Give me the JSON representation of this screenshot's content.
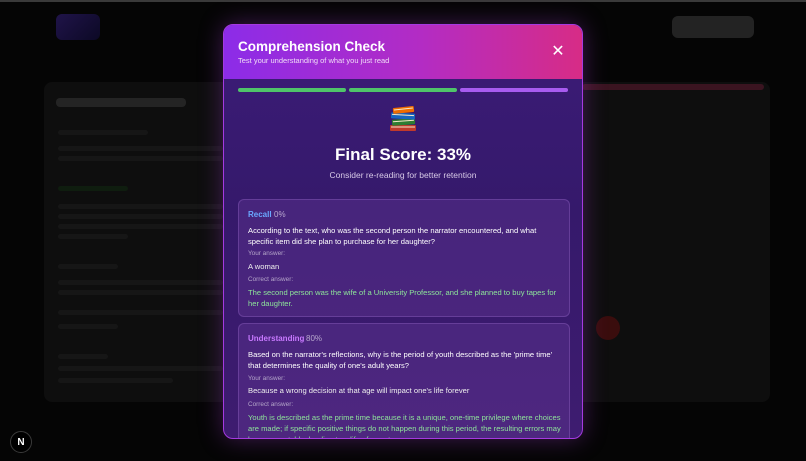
{
  "modal": {
    "title": "Comprehension Check",
    "subtitle": "Test your understanding of what you just read",
    "close_icon": "close-icon",
    "progress": [
      "complete",
      "complete",
      "active"
    ],
    "result_icon": "books-icon",
    "score_text": "Final Score: 33%",
    "score_note": "Consider re-reading for better retention",
    "labels": {
      "your_answer": "Your answer:",
      "correct_answer": "Correct answer:"
    },
    "questions": [
      {
        "category": "Recall",
        "percent": "0%",
        "question": "According to the text, who was the second person the narrator encountered, and what specific item did she plan to purchase for her daughter?",
        "your_answer": "A woman",
        "correct_answer": "The second person was the wife of a University Professor, and she planned to buy tapes for her daughter."
      },
      {
        "category": "Understanding",
        "percent": "80%",
        "question": "Based on the narrator's reflections, why is the period of youth described as the 'prime time' that determines the quality of one's adult years?",
        "your_answer": "Because a wrong decision at that age will impact one's life forever",
        "correct_answer": "Youth is described as the prime time because it is a unique, one-time privilege where choices are made; if specific positive things do not happen during this period, the resulting errors may be uncorrectable, leading to a life of regret."
      }
    ]
  },
  "background": {
    "badge_letter": "N"
  },
  "colors": {
    "header_start": "#8c2ce8",
    "header_end": "#d72c86",
    "progress_done": "#4fc46a",
    "progress_active": "#a85cf0",
    "recall": "#6aa8ff",
    "understanding": "#c879ff",
    "correct_answer": "#8ee59a"
  }
}
